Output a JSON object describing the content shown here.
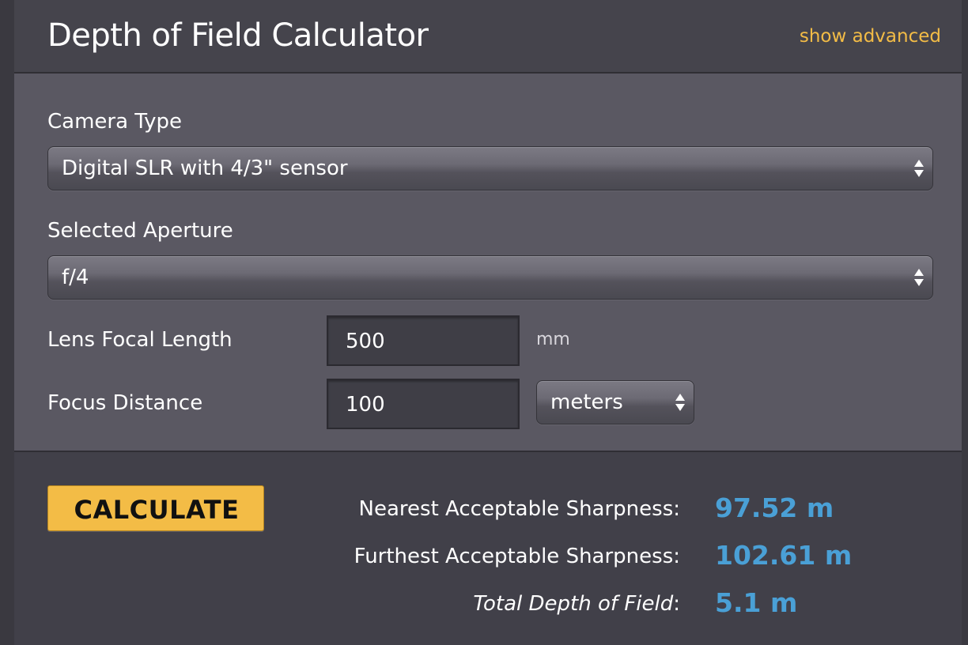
{
  "header": {
    "title": "Depth of Field Calculator",
    "show_advanced": "show advanced"
  },
  "form": {
    "camera_type": {
      "label": "Camera Type",
      "selected": "Digital SLR with 4/3\" sensor"
    },
    "aperture": {
      "label": "Selected Aperture",
      "selected": "f/4"
    },
    "focal_length": {
      "label": "Lens Focal Length",
      "value": "500",
      "unit": "mm"
    },
    "focus_distance": {
      "label": "Focus Distance",
      "value": "100",
      "unit_selected": "meters"
    }
  },
  "results": {
    "calculate_label": "CALCULATE",
    "nearest": {
      "label": "Nearest Acceptable Sharpness:",
      "value": "97.52 m"
    },
    "furthest": {
      "label": "Furthest Acceptable Sharpness:",
      "value": "102.61 m"
    },
    "total": {
      "label": "Total Depth of Field",
      "suffix": ":",
      "value": "5.1 m"
    }
  },
  "colors": {
    "accent": "#f3bc46",
    "result_value": "#4aa0d6",
    "form_background": "#5a5862",
    "panel_background": "#414049"
  }
}
